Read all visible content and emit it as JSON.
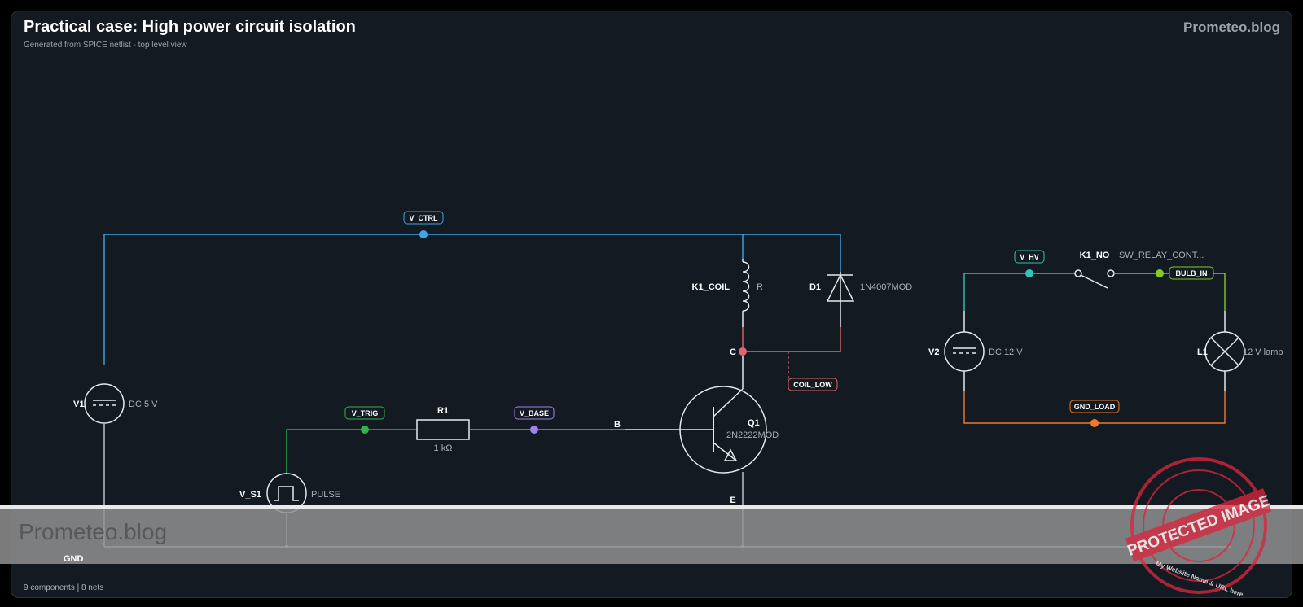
{
  "header": {
    "title": "Practical case: High power circuit isolation",
    "subtitle": "Generated from SPICE netlist - top level view",
    "brand": "Prometeo.blog"
  },
  "footer": {
    "stats": "9 components | 8 nets"
  },
  "components": {
    "v1": {
      "name": "V1",
      "value": "DC 5 V"
    },
    "vs1": {
      "name": "V_S1",
      "value": "PULSE"
    },
    "r1": {
      "name": "R1",
      "value": "1 kΩ"
    },
    "k1coil": {
      "name": "K1_COIL",
      "value": "R"
    },
    "d1": {
      "name": "D1",
      "value": "1N4007MOD"
    },
    "q1": {
      "name": "Q1",
      "value": "2N2222MOD",
      "pin_c": "C",
      "pin_b": "B",
      "pin_e": "E"
    },
    "v2": {
      "name": "V2",
      "value": "DC 12 V"
    },
    "k1no": {
      "name": "K1_NO",
      "value": "SW_RELAY_CONT..."
    },
    "l1": {
      "name": "L1",
      "value": "12 V lamp"
    }
  },
  "nets": {
    "v_ctrl": {
      "label": "V_CTRL",
      "color": "#3ea6e6"
    },
    "v_trig": {
      "label": "V_TRIG",
      "color": "#2fb24f"
    },
    "v_base": {
      "label": "V_BASE",
      "color": "#9b84e8"
    },
    "coil_low": {
      "label": "COIL_LOW",
      "color": "#e0656f"
    },
    "gnd": {
      "label": "GND",
      "color": "#c8ccd0"
    },
    "v_hv": {
      "label": "V_HV",
      "color": "#2dc6b0"
    },
    "bulb_in": {
      "label": "BULB_IN",
      "color": "#84cc24"
    },
    "gnd_load": {
      "label": "GND_LOAD",
      "color": "#ef7a2a"
    }
  },
  "watermark": {
    "band_text": "Prometeo.blog",
    "stamp_text": "PROTECTED IMAGE",
    "stamp_ring_text": "My Website Name & URL here"
  }
}
